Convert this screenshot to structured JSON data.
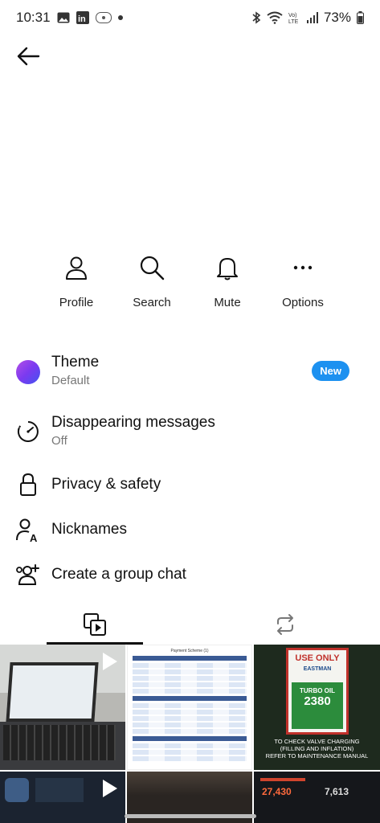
{
  "status_bar": {
    "time": "10:31",
    "battery": "73%",
    "left_icons": [
      "gallery-icon",
      "linkedin-icon",
      "app-icon",
      "dot-icon"
    ],
    "right_icons": [
      "bluetooth-icon",
      "wifi-icon",
      "volte-icon",
      "signal-icon"
    ]
  },
  "actions": [
    {
      "label": "Profile",
      "icon": "person-icon"
    },
    {
      "label": "Search",
      "icon": "search-icon"
    },
    {
      "label": "Mute",
      "icon": "bell-icon"
    },
    {
      "label": "Options",
      "icon": "more-icon"
    }
  ],
  "menu": {
    "theme": {
      "title": "Theme",
      "subtitle": "Default",
      "badge": "New"
    },
    "disappearing": {
      "title": "Disappearing messages",
      "subtitle": "Off"
    },
    "privacy": {
      "title": "Privacy & safety"
    },
    "nicknames": {
      "title": "Nicknames"
    },
    "group_chat": {
      "title": "Create a group chat"
    }
  },
  "tabs": [
    {
      "name": "media",
      "icon": "media-gallery-icon",
      "selected": true
    },
    {
      "name": "shared",
      "icon": "repeat-icon",
      "selected": false
    }
  ],
  "media": {
    "sheet_title": "Payment Scheme (1)",
    "placard_use_only": "USE ONLY",
    "placard_brand": "EASTMAN",
    "placard_product": "TURBO OIL",
    "placard_number": "2380",
    "placard_note_lines": [
      "TO CHECK VALVE CHARGING",
      "(FILLING AND INFLATION)",
      "REFER TO MAINTENANCE MANUAL"
    ],
    "stat_1": "27,430",
    "stat_2": "7,613"
  },
  "colors": {
    "accent": "#1d91f0",
    "sheet_header": "#3a5a94"
  }
}
